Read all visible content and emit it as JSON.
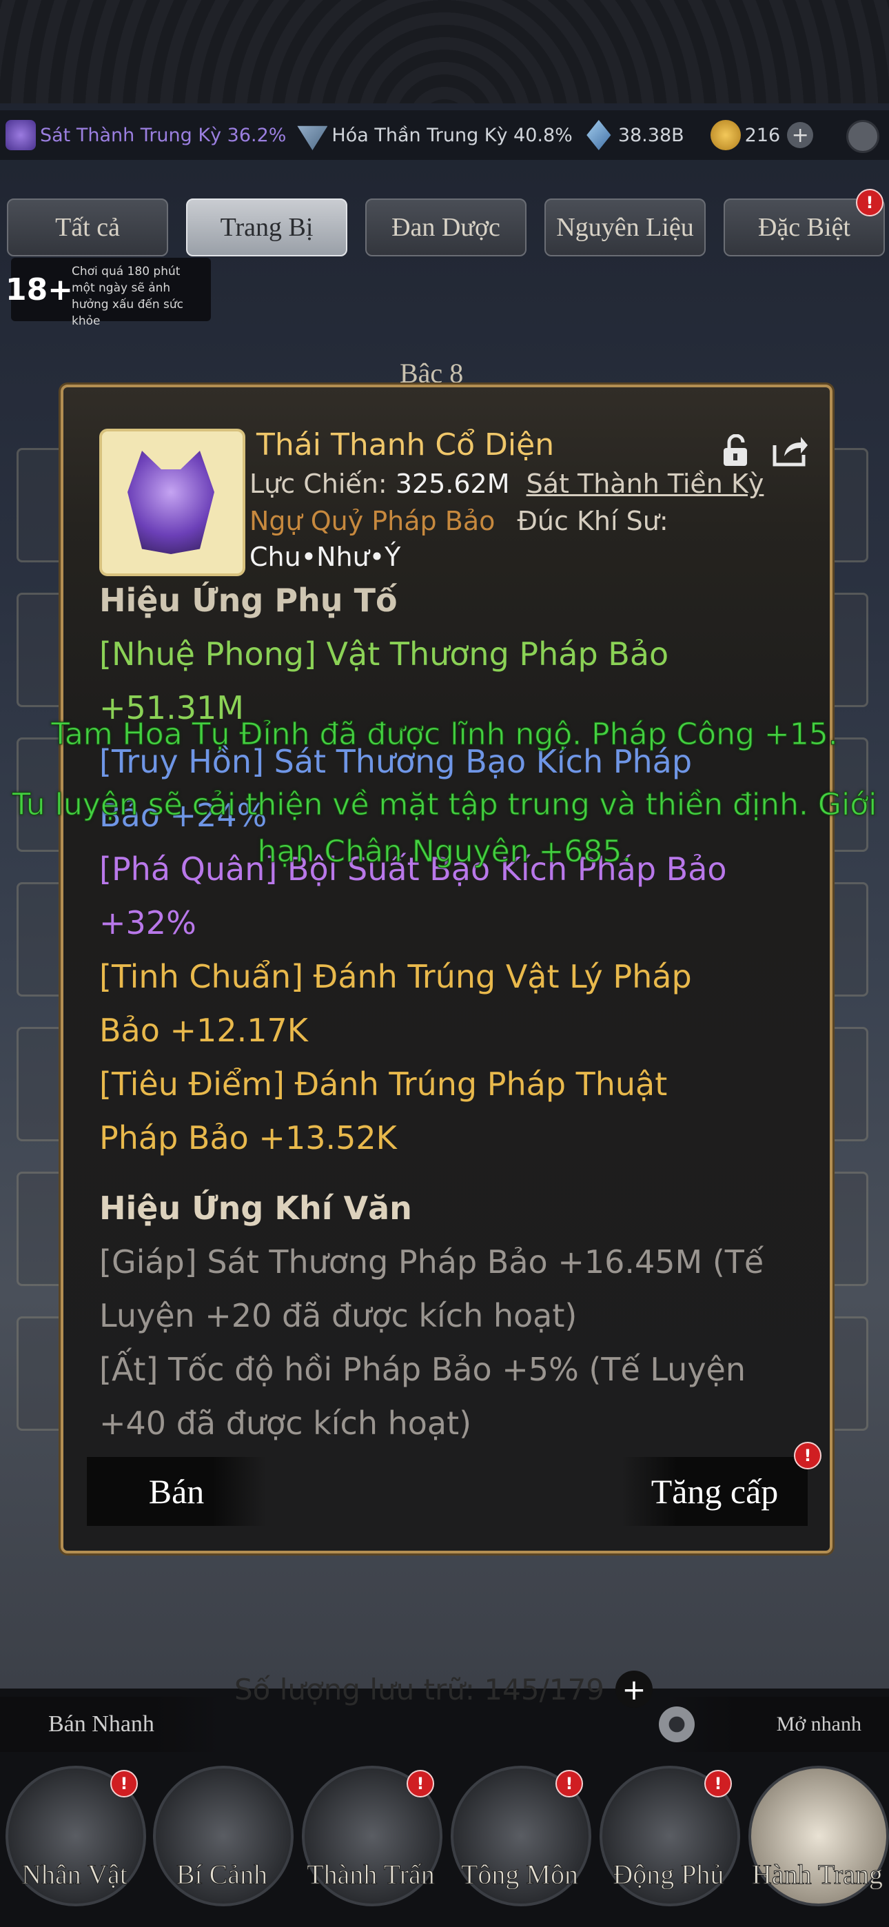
{
  "currency_bar": {
    "realm1": "Sát Thành Trung Kỳ 36.2%",
    "realm2": "Hóa Thần Trung Kỳ 40.8%",
    "crystals": "38.38B",
    "coins": "216",
    "plus": "+"
  },
  "tabs": [
    {
      "label": "Tất cả"
    },
    {
      "label": "Trang Bị"
    },
    {
      "label": "Đan Dược"
    },
    {
      "label": "Nguyên Liệu"
    },
    {
      "label": "Đặc Biệt"
    }
  ],
  "badge": "!",
  "age_notice": {
    "badge": "18+",
    "text": "Chơi quá 180 phút một ngày sẽ ảnh hưởng xấu đến sức khỏe"
  },
  "rank_label": "Bậc 8",
  "item": {
    "name": "Thái Thanh Cổ Diện",
    "power_label": "Lực Chiến:",
    "power_value": "325.62M",
    "realm_req": "Sát Thành Tiền Kỳ",
    "category": "Ngự Quỷ Pháp Bảo",
    "forger_label": "Đúc Khí Sư:",
    "forger_name": "Chu•Như•Ý"
  },
  "effects": {
    "sub_title": "Hiệu Ứng Phụ Tố",
    "lines": [
      "[Nhuệ Phong] Vật Thương Pháp Bảo",
      "+51.31M",
      "[Truy Hồn] Sát Thương Bạo Kích Pháp",
      "Bảo +24%",
      "[Phá Quân] Bội Suất Bạo Kích Pháp Bảo",
      "+32%",
      "[Tinh Chuẩn] Đánh Trúng Vật Lý Pháp",
      "Bảo +12.17K",
      "[Tiêu Điểm] Đánh Trúng Pháp Thuật",
      "Pháp Bảo +13.52K"
    ],
    "aura_title": "Hiệu Ứng Khí Văn",
    "aura_lines": [
      "[Giáp] Sát Thương Pháp Bảo +16.45M (Tế",
      "Luyện +20 đã được kích hoạt)",
      "[Ất] Tốc độ hồi Pháp Bảo +5% (Tế Luyện",
      "+40 đã được kích hoạt)"
    ]
  },
  "actions": {
    "sell": "Bán",
    "upgrade": "Tăng cấp"
  },
  "toast": {
    "line1": "Tam Hoa Tụ Đỉnh đã được lĩnh ngộ. Pháp Công +15.",
    "line2": "Tu luyện sẽ cải thiện về mặt tập trung và thiền định. Giới",
    "line3": "hạn Chân Nguyên +685."
  },
  "storage": {
    "label": "Số lượng lưu trữ: 145/179",
    "plus": "+"
  },
  "quick_sell": "Bán Nhanh",
  "quick_open": "Mở nhanh",
  "nav": [
    {
      "label": "Nhân Vật"
    },
    {
      "label": "Bí Cảnh"
    },
    {
      "label": "Thành Trấn"
    },
    {
      "label": "Tông Môn"
    },
    {
      "label": "Động Phủ"
    },
    {
      "label": "Hành Trang"
    }
  ]
}
